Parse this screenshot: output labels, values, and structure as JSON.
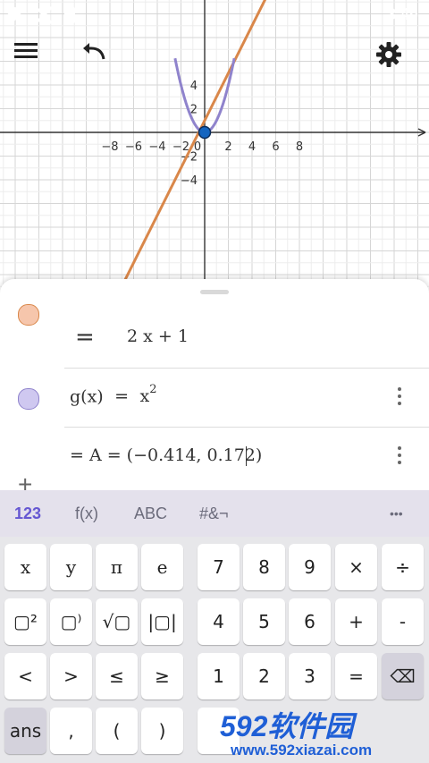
{
  "status_bar": {
    "time": "3:46"
  },
  "graph": {
    "x_ticks": [
      "−8",
      "−6",
      "−4",
      "−2",
      "0",
      "2",
      "4",
      "6",
      "8"
    ],
    "y_ticks": [
      "4",
      "2",
      "−2",
      "−4"
    ],
    "curve_colors": {
      "line": "#d9874a",
      "parabola": "#8f83cc",
      "point": "#1565c0"
    }
  },
  "algebra": {
    "row1": {
      "equals": "=",
      "value": "2 x + 1"
    },
    "row2": {
      "name": "g(x)",
      "equals": "=",
      "base": "x",
      "exponent": "2"
    },
    "row3": {
      "text": "= A = (−0.414, 0.172)"
    },
    "add_label": "+"
  },
  "keyboard": {
    "tabs": [
      "123",
      "f(x)",
      "ABC",
      "#&¬"
    ],
    "more": "•••",
    "left_keys": [
      [
        "x",
        "y",
        "π",
        "e"
      ],
      [
        "▢²",
        "▢⁾",
        "√▢",
        "|▢|"
      ],
      [
        "<",
        ">",
        "≤",
        "≥"
      ],
      [
        "ans",
        ",",
        "(",
        ")"
      ]
    ],
    "right_keys": [
      [
        "7",
        "8",
        "9",
        "×",
        "÷"
      ],
      [
        "4",
        "5",
        "6",
        "+",
        "-"
      ],
      [
        "1",
        "2",
        "3",
        "=",
        "⌫"
      ]
    ]
  },
  "watermark": {
    "brand": "592软件园",
    "url": "www.592xiazai.com"
  }
}
